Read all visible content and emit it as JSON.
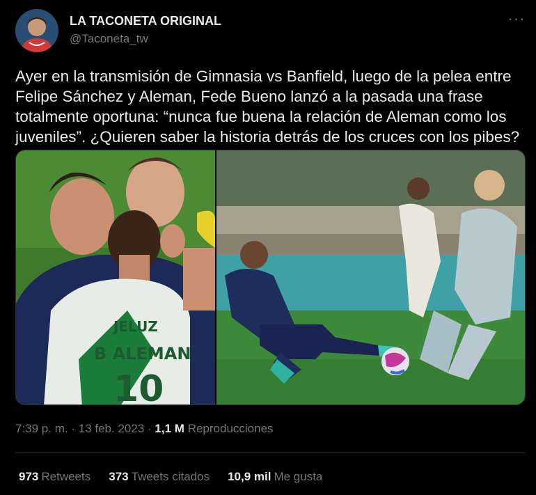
{
  "tweet": {
    "author_name": "LA TACONETA ORIGINAL",
    "author_handle": "@Taconeta_tw",
    "text": "Ayer en la transmisión de Gimnasia vs Banfield, luego de la pelea entre Felipe Sánchez y Aleman, Fede Bueno lanzó a la pasada una frase totalmente oportuna: “nunca fue buena la relación de Aleman como los juveniles”. ¿Quieren saber la historia detrás de los cruces con los pibes?",
    "more_icon": "more-icon",
    "jersey_text": {
      "sponsor": "JELUZ",
      "name": "B ALEMAN",
      "number": "10"
    },
    "time": "7:39 p. m.",
    "date": "13 feb. 2023",
    "separator": "·",
    "views_count": "1,1 M",
    "views_label": "Reproducciones"
  },
  "stats": {
    "retweets_count": "973",
    "retweets_label": "Retweets",
    "quotes_count": "373",
    "quotes_label": "Tweets citados",
    "likes_count": "10,9 mil",
    "likes_label": "Me gusta"
  },
  "colors": {
    "background": "#000000",
    "text_primary": "#e7e9ea",
    "text_secondary": "#71767b",
    "divider": "#2f3336"
  }
}
